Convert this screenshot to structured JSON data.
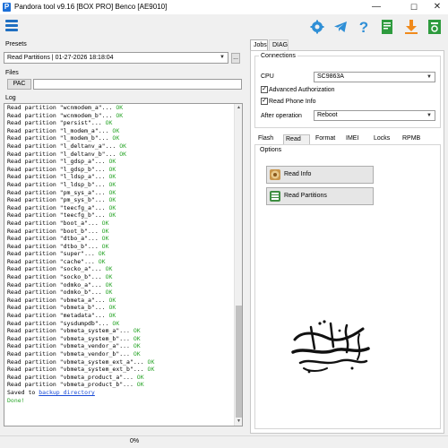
{
  "window": {
    "title": "Pandora tool v9.16 [BOX PRO] Benco [AE9010]",
    "app_icon": "P",
    "minimize_glyph": "—",
    "maximize_glyph": "☐",
    "close_glyph": "✕"
  },
  "toolbar": {
    "icons": [
      "menu-icon",
      "gear-icon",
      "telegram-icon",
      "help-icon",
      "document-icon",
      "download-icon",
      "power-icon"
    ]
  },
  "presets": {
    "label": "Presets",
    "value": "Read Partitions | 01-27-2026 18:18:04",
    "more_label": "..."
  },
  "files": {
    "label": "Files",
    "pac_label": "PAC",
    "pac_value": ""
  },
  "log": {
    "label": "Log",
    "lines": [
      {
        "text": "Read partition \"wcnmodem_a\"... ",
        "status": "OK"
      },
      {
        "text": "Read partition \"wcnmodem_b\"... ",
        "status": "OK"
      },
      {
        "text": "Read partition \"persist\"... ",
        "status": "OK"
      },
      {
        "text": "Read partition \"l_modem_a\"... ",
        "status": "OK"
      },
      {
        "text": "Read partition \"l_modem_b\"... ",
        "status": "OK"
      },
      {
        "text": "Read partition \"l_deltanv_a\"... ",
        "status": "OK"
      },
      {
        "text": "Read partition \"l_deltanv_b\"... ",
        "status": "OK"
      },
      {
        "text": "Read partition \"l_gdsp_a\"... ",
        "status": "OK"
      },
      {
        "text": "Read partition \"l_gdsp_b\"... ",
        "status": "OK"
      },
      {
        "text": "Read partition \"l_ldsp_a\"... ",
        "status": "OK"
      },
      {
        "text": "Read partition \"l_ldsp_b\"... ",
        "status": "OK"
      },
      {
        "text": "Read partition \"pm_sys_a\"... ",
        "status": "OK"
      },
      {
        "text": "Read partition \"pm_sys_b\"... ",
        "status": "OK"
      },
      {
        "text": "Read partition \"teecfg_a\"... ",
        "status": "OK"
      },
      {
        "text": "Read partition \"teecfg_b\"... ",
        "status": "OK"
      },
      {
        "text": "Read partition \"boot_a\"... ",
        "status": "OK"
      },
      {
        "text": "Read partition \"boot_b\"... ",
        "status": "OK"
      },
      {
        "text": "Read partition \"dtbo_a\"... ",
        "status": "OK"
      },
      {
        "text": "Read partition \"dtbo_b\"... ",
        "status": "OK"
      },
      {
        "text": "Read partition \"super\"... ",
        "status": "OK"
      },
      {
        "text": "Read partition \"cache\"... ",
        "status": "OK"
      },
      {
        "text": "Read partition \"socko_a\"... ",
        "status": "OK"
      },
      {
        "text": "Read partition \"socko_b\"... ",
        "status": "OK"
      },
      {
        "text": "Read partition \"odmko_a\"... ",
        "status": "OK"
      },
      {
        "text": "Read partition \"odmko_b\"... ",
        "status": "OK"
      },
      {
        "text": "Read partition \"vbmeta_a\"... ",
        "status": "OK"
      },
      {
        "text": "Read partition \"vbmeta_b\"... ",
        "status": "OK"
      },
      {
        "text": "Read partition \"metadata\"... ",
        "status": "OK"
      },
      {
        "text": "Read partition \"sysdumpdb\"... ",
        "status": "OK"
      },
      {
        "text": "Read partition \"vbmeta_system_a\"... ",
        "status": "OK"
      },
      {
        "text": "Read partition \"vbmeta_system_b\"... ",
        "status": "OK"
      },
      {
        "text": "Read partition \"vbmeta_vendor_a\"... ",
        "status": "OK"
      },
      {
        "text": "Read partition \"vbmeta_vendor_b\"... ",
        "status": "OK"
      },
      {
        "text": "Read partition \"vbmeta_system_ext_a\"... ",
        "status": "OK"
      },
      {
        "text": "Read partition \"vbmeta_system_ext_b\"... ",
        "status": "OK"
      },
      {
        "text": "Read partition \"vbmeta_product_a\"... ",
        "status": "OK"
      },
      {
        "text": "Read partition \"vbmeta_product_b\"... ",
        "status": "OK"
      }
    ],
    "saved_prefix": "Saved to ",
    "saved_link": "backup directory",
    "done": "Done!"
  },
  "status": {
    "progress_text": "0%",
    "progress": 0
  },
  "right_tabs": [
    "Jobs",
    "DIAG"
  ],
  "connections": {
    "title": "Connections",
    "cpu_label": "CPU",
    "cpu_value": "SC9863A",
    "advanced_auth_label": "Advanced Authorization",
    "advanced_auth_checked": true,
    "read_phone_info_label": "Read Phone Info",
    "read_phone_info_checked": true,
    "after_operation_label": "After operation",
    "after_operation_value": "Reboot",
    "check_glyph": "✓"
  },
  "function_tabs": [
    "Flash",
    "Read",
    "Format",
    "IMEI",
    "Locks",
    "RPMB"
  ],
  "active_function_tab": "Read",
  "options": {
    "title": "Options",
    "read_info_label": "Read Info",
    "read_partitions_label": "Read Partitions"
  },
  "colors": {
    "accent": "#1f6fc1",
    "ok": "#2aa52a",
    "link": "#1a4bd6"
  }
}
